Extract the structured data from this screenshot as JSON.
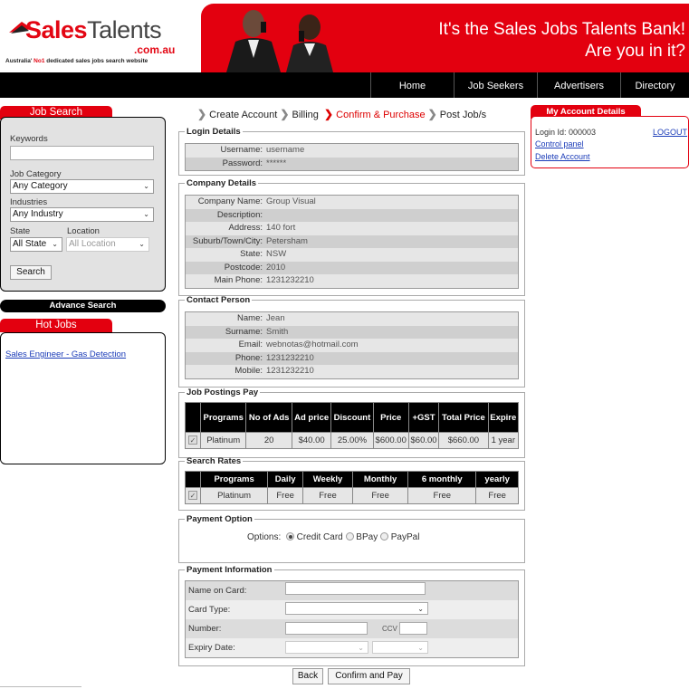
{
  "header": {
    "logo": {
      "sales": "Sales",
      "talents": "Talents",
      "domain": ".com.au",
      "tagline_pre": "Australia' ",
      "tagline_no1": "No1",
      "tagline_post": " dedicated sales jobs search website"
    },
    "banner_line1": "It's the Sales Jobs Talents Bank!",
    "banner_line2": "Are you in it?",
    "colors": {
      "brand_red": "#e3000f",
      "nav_bg": "#000000",
      "link": "#1a3bb8"
    }
  },
  "nav": {
    "items": [
      "Home",
      "Job Seekers",
      "Advertisers",
      "Directory"
    ]
  },
  "left": {
    "job_search": {
      "title": "Job Search",
      "keywords_label": "Keywords",
      "keywords_value": "",
      "category_label": "Job Category",
      "category_value": "Any Category",
      "industries_label": "Industries",
      "industries_value": "Any Industry",
      "state_label": "State",
      "state_value": "All State",
      "location_label": "Location",
      "location_value": "All Location",
      "search_button": "Search"
    },
    "advance_search": "Advance Search",
    "hot_jobs": {
      "title": "Hot Jobs",
      "items": [
        "Sales Engineer - Gas Detection"
      ]
    }
  },
  "steps": {
    "s1": "Create Account",
    "s2": "Billing",
    "s3": "Confirm & Purchase",
    "s4": "Post Job/s"
  },
  "login_details": {
    "legend": "Login Details",
    "rows": [
      {
        "k": "Username:",
        "v": "username"
      },
      {
        "k": "Password:",
        "v": "******"
      }
    ]
  },
  "company_details": {
    "legend": "Company Details",
    "rows": [
      {
        "k": "Company Name:",
        "v": "Group Visual"
      },
      {
        "k": "Description:",
        "v": ""
      },
      {
        "k": "Address:",
        "v": "140 fort"
      },
      {
        "k": "Suburb/Town/City:",
        "v": "Petersham"
      },
      {
        "k": "State:",
        "v": "NSW"
      },
      {
        "k": "Postcode:",
        "v": "2010"
      },
      {
        "k": "Main Phone:",
        "v": "1231232210"
      }
    ]
  },
  "contact_person": {
    "legend": "Contact Person",
    "rows": [
      {
        "k": "Name:",
        "v": "Jean"
      },
      {
        "k": "Surname:",
        "v": "Smith"
      },
      {
        "k": "Email:",
        "v": "webnotas@hotmail.com"
      },
      {
        "k": "Phone:",
        "v": "1231232210"
      },
      {
        "k": "Mobile:",
        "v": "1231232210"
      }
    ]
  },
  "job_postings": {
    "legend": "Job Postings Pay",
    "headers": [
      "Programs",
      "No of Ads",
      "Ad price",
      "Discount",
      "Price",
      "+GST",
      "Total Price",
      "Expire"
    ],
    "row": [
      "Platinum",
      "20",
      "$40.00",
      "25.00%",
      "$600.00",
      "$60.00",
      "$660.00",
      "1 year"
    ]
  },
  "search_rates": {
    "legend": "Search Rates",
    "headers": [
      "Programs",
      "Daily",
      "Weekly",
      "Monthly",
      "6 monthly",
      "yearly"
    ],
    "row": [
      "Platinum",
      "Free",
      "Free",
      "Free",
      "Free",
      "Free"
    ]
  },
  "payment_option": {
    "legend": "Payment Option",
    "label": "Options:",
    "opt1": "Credit Card",
    "opt2": "BPay",
    "opt3": "PayPal",
    "selected": "Credit Card"
  },
  "payment_info": {
    "legend": "Payment Information",
    "name_label": "Name on Card:",
    "type_label": "Card Type:",
    "number_label": "Number:",
    "ccv_label": "CCV",
    "expiry_label": "Expiry Date:"
  },
  "buttons": {
    "back": "Back",
    "confirm": "Confirm and Pay"
  },
  "account": {
    "title": "My Account Details",
    "login_id": "Login Id: 000003",
    "logout": "LOGOUT",
    "control_panel": "Control panel",
    "delete_account": "Delete Account"
  }
}
